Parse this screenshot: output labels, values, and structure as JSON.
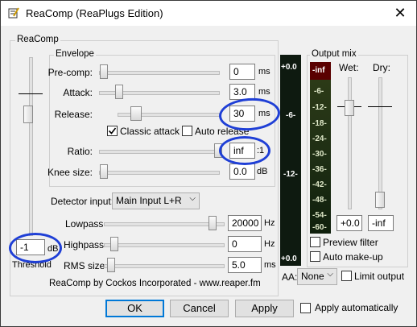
{
  "window": {
    "title": "ReaComp (ReaPlugs Edition)",
    "close_glyph": "✕"
  },
  "main_group_label": "ReaComp",
  "envelope": {
    "label": "Envelope",
    "precomp": {
      "label": "Pre-comp:",
      "value": "0",
      "unit": "ms"
    },
    "attack": {
      "label": "Attack:",
      "value": "3.0",
      "unit": "ms"
    },
    "release": {
      "label": "Release:",
      "value": "30",
      "unit": "ms"
    },
    "classic_attack": {
      "label": "Classic attack",
      "checked": true
    },
    "auto_release": {
      "label": "Auto release",
      "checked": false
    },
    "ratio": {
      "label": "Ratio:",
      "value": "inf",
      "unit": ":1"
    },
    "knee": {
      "label": "Knee size:",
      "value": "0.0",
      "unit": "dB"
    }
  },
  "detector": {
    "label": "Detector input:",
    "selected": "Main Input L+R"
  },
  "lowpass": {
    "label": "Lowpass",
    "value": "20000",
    "unit": "Hz"
  },
  "highpass": {
    "label": "Highpass",
    "value": "0",
    "unit": "Hz"
  },
  "rms": {
    "label": "RMS size",
    "value": "5.0",
    "unit": "ms"
  },
  "threshold": {
    "label": "Threshold",
    "value": "-1",
    "unit": "dB"
  },
  "credit": "ReaComp by Cockos Incorporated - www.reaper.fm",
  "meter": {
    "top_label": "+0.0",
    "mid_label": "-6-",
    "low_label": "-12-",
    "bottom_label": "+0.0"
  },
  "output_mix": {
    "label": "Output mix",
    "gr_top": "-inf",
    "gr_scale": [
      "-6-",
      "-12-",
      "-18-",
      "-24-",
      "-30-",
      "-36-",
      "-42-",
      "-48-",
      "-54-",
      "-60-"
    ],
    "wet_label": "Wet:",
    "dry_label": "Dry:",
    "wet_value": "+0.0",
    "dry_value": "-inf",
    "preview_filter": {
      "label": "Preview filter",
      "checked": false
    },
    "auto_makeup": {
      "label": "Auto make-up",
      "checked": false
    }
  },
  "aa": {
    "label": "AA:",
    "selected": "None"
  },
  "limit_output": {
    "label": "Limit output",
    "checked": false
  },
  "buttons": {
    "ok": "OK",
    "cancel": "Cancel",
    "apply": "Apply"
  },
  "apply_automatically": {
    "label": "Apply automatically",
    "checked": false
  },
  "colors": {
    "annotation": "#1f3fd6",
    "focus": "#0078d7",
    "meter_bg": "#0e1a10"
  }
}
